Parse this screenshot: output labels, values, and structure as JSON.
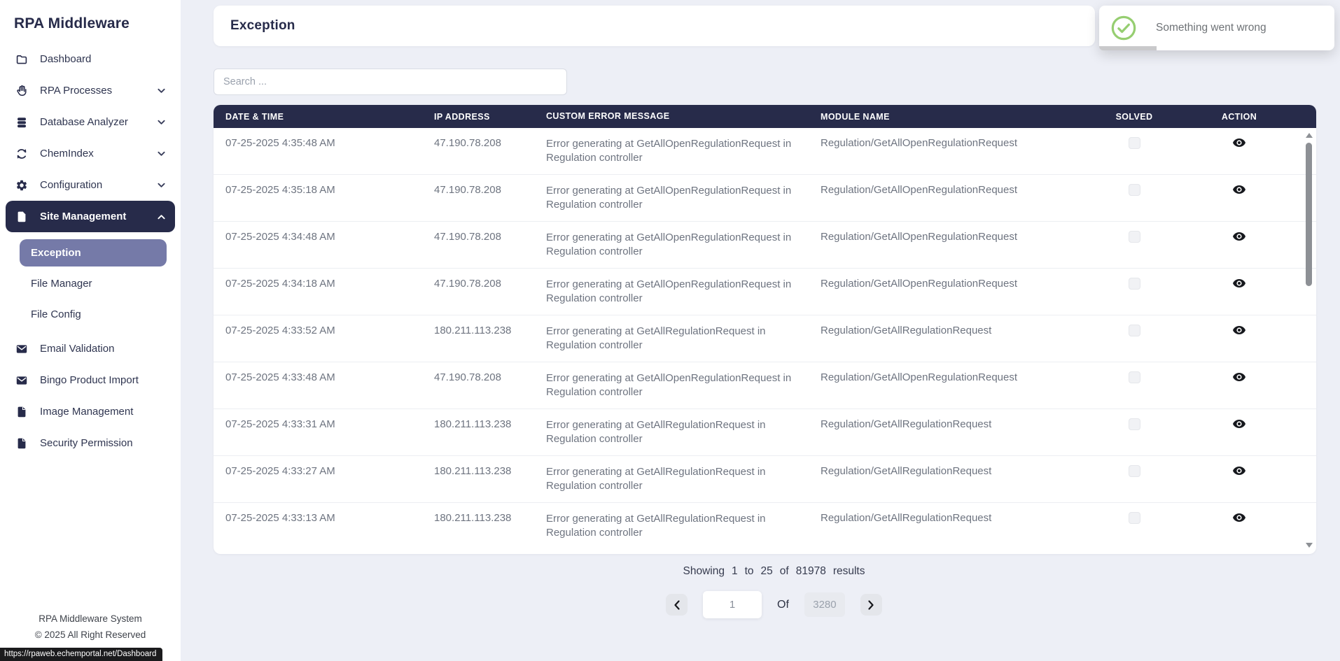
{
  "app_title": "RPA Middleware",
  "sidebar": {
    "items": [
      {
        "label": "Dashboard",
        "icon": "folder-icon"
      },
      {
        "label": "RPA Processes",
        "icon": "hand-icon",
        "chevron": "down"
      },
      {
        "label": "Database Analyzer",
        "icon": "database-icon",
        "chevron": "down"
      },
      {
        "label": "ChemIndex",
        "icon": "sync-icon",
        "chevron": "down"
      },
      {
        "label": "Configuration",
        "icon": "gear-icon",
        "chevron": "down"
      },
      {
        "label": "Site Management",
        "icon": "file-icon",
        "chevron": "up",
        "active": true
      }
    ],
    "sub_items": [
      {
        "label": "Exception",
        "active": true
      },
      {
        "label": "File Manager",
        "active": false
      },
      {
        "label": "File Config",
        "active": false
      }
    ],
    "items_bottom": [
      {
        "label": "Email Validation",
        "icon": "envelope-icon"
      },
      {
        "label": "Bingo Product Import",
        "icon": "envelope-icon"
      },
      {
        "label": "Image Management",
        "icon": "file-icon"
      },
      {
        "label": "Security Permission",
        "icon": "file-icon"
      }
    ],
    "footer_line1": "RPA Middleware System",
    "footer_line2": "© 2025 All Right Reserved"
  },
  "statusbar_url": "https://rpaweb.echemportal.net/Dashboard",
  "toast": {
    "icon": "check-circle-icon",
    "message": "Something went wrong"
  },
  "page": {
    "title": "Exception"
  },
  "search": {
    "placeholder": "Search ..."
  },
  "table": {
    "columns": [
      "DATE & TIME",
      "IP ADDRESS",
      "CUSTOM ERROR MESSAGE",
      "MODULE NAME",
      "SOLVED",
      "ACTION"
    ],
    "rows": [
      {
        "datetime": "07-25-2025 4:35:48 AM",
        "ip": "47.190.78.208",
        "message": "Error generating at GetAllOpenRegulationRequest in Regulation controller",
        "module": "Regulation/GetAllOpenRegulationRequest",
        "solved": false
      },
      {
        "datetime": "07-25-2025 4:35:18 AM",
        "ip": "47.190.78.208",
        "message": "Error generating at GetAllOpenRegulationRequest in Regulation controller",
        "module": "Regulation/GetAllOpenRegulationRequest",
        "solved": false
      },
      {
        "datetime": "07-25-2025 4:34:48 AM",
        "ip": "47.190.78.208",
        "message": "Error generating at GetAllOpenRegulationRequest in Regulation controller",
        "module": "Regulation/GetAllOpenRegulationRequest",
        "solved": false
      },
      {
        "datetime": "07-25-2025 4:34:18 AM",
        "ip": "47.190.78.208",
        "message": "Error generating at GetAllOpenRegulationRequest in Regulation controller",
        "module": "Regulation/GetAllOpenRegulationRequest",
        "solved": false
      },
      {
        "datetime": "07-25-2025 4:33:52 AM",
        "ip": "180.211.113.238",
        "message": "Error generating at GetAllRegulationRequest in Regulation controller",
        "module": "Regulation/GetAllRegulationRequest",
        "solved": false
      },
      {
        "datetime": "07-25-2025 4:33:48 AM",
        "ip": "47.190.78.208",
        "message": "Error generating at GetAllOpenRegulationRequest in Regulation controller",
        "module": "Regulation/GetAllOpenRegulationRequest",
        "solved": false
      },
      {
        "datetime": "07-25-2025 4:33:31 AM",
        "ip": "180.211.113.238",
        "message": "Error generating at GetAllRegulationRequest in Regulation controller",
        "module": "Regulation/GetAllRegulationRequest",
        "solved": false
      },
      {
        "datetime": "07-25-2025 4:33:27 AM",
        "ip": "180.211.113.238",
        "message": "Error generating at GetAllRegulationRequest in Regulation controller",
        "module": "Regulation/GetAllRegulationRequest",
        "solved": false
      },
      {
        "datetime": "07-25-2025 4:33:13 AM",
        "ip": "180.211.113.238",
        "message": "Error generating at GetAllRegulationRequest in Regulation controller",
        "module": "Regulation/GetAllRegulationRequest",
        "solved": false
      }
    ]
  },
  "pagination": {
    "showing_word": "Showing",
    "from": "1",
    "to_word": "to",
    "to": "25",
    "of_word": "of",
    "total_results": "81978",
    "results_word": "results",
    "current_page": "1",
    "of_label": "Of",
    "total_pages": "3280"
  },
  "colors": {
    "navy": "#272b4a",
    "active_subnav": "#757aa8",
    "toast_green": "#96ce71",
    "page_background": "#edeff6",
    "row_text": "#6e7480"
  }
}
